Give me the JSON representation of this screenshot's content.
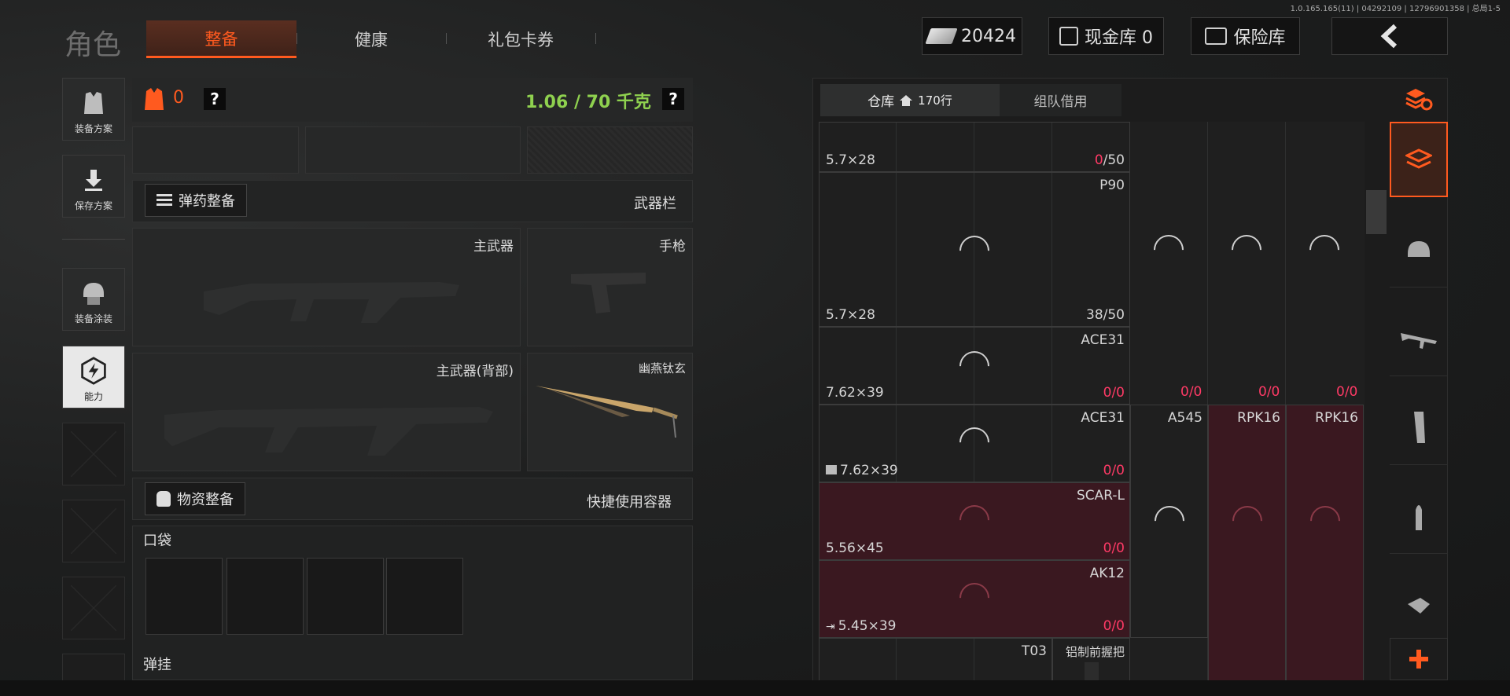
{
  "version_info": "1.0.165.165(11) | 04292109 | 12796901358 | 总局1-5",
  "header": {
    "title": "角色",
    "tabs": [
      {
        "label": "整备"
      },
      {
        "label": "健康"
      },
      {
        "label": "礼包卡券"
      }
    ],
    "currency": "20424",
    "cash_vault": "现金库 0",
    "safe": "保险库"
  },
  "sidebar": {
    "items": [
      {
        "label": "装备方案",
        "icon": "vest-icon"
      },
      {
        "label": "保存方案",
        "icon": "download-icon"
      },
      {
        "label": "装备涂装",
        "icon": "helmet-icon"
      },
      {
        "label": "能力",
        "icon": "lightning-icon"
      }
    ]
  },
  "equipment": {
    "armor_count": "0",
    "help": "?",
    "weight": "1.06 / 70 千克",
    "ammo_btn": "弹药整备",
    "weapon_bar": "武器栏",
    "primary": "主武器",
    "pistol": "手枪",
    "primary_back": "主武器(背部)",
    "melee": "幽燕钛玄",
    "supply_btn": "物资整备",
    "quick_container": "快捷使用容器",
    "pockets": "口袋",
    "rig": "弹挂"
  },
  "storage": {
    "tab_warehouse": "仓库",
    "rows": "170行",
    "tab_team": "组队借用",
    "cells": {
      "r0_ammo": "5.7×28",
      "r0_cnt_a": "0",
      "r0_cnt_b": "/50",
      "p90": "P90",
      "p90_ammo": "5.7×28",
      "p90_cnt": "38/50",
      "ace31a": "ACE31",
      "ace31a_ammo": "7.62×39",
      "ace31b": "ACE31",
      "ace31b_ammo": "7.62×39",
      "a545": "A545",
      "rpk16a": "RPK16",
      "rpk16b": "RPK16",
      "scar": "SCAR-L",
      "scar_ammo": "5.56×45",
      "ak12": "AK12",
      "ak12_ammo": "5.45×39",
      "t03": "T03",
      "grip": "铝制前握把",
      "zero": "0",
      "slash_zero": "/0"
    }
  },
  "colors": {
    "accent": "#ff5a1f",
    "weight_green": "#8fd14f",
    "count_pink": "#ff3a66",
    "red_cell": "#3a1820"
  }
}
